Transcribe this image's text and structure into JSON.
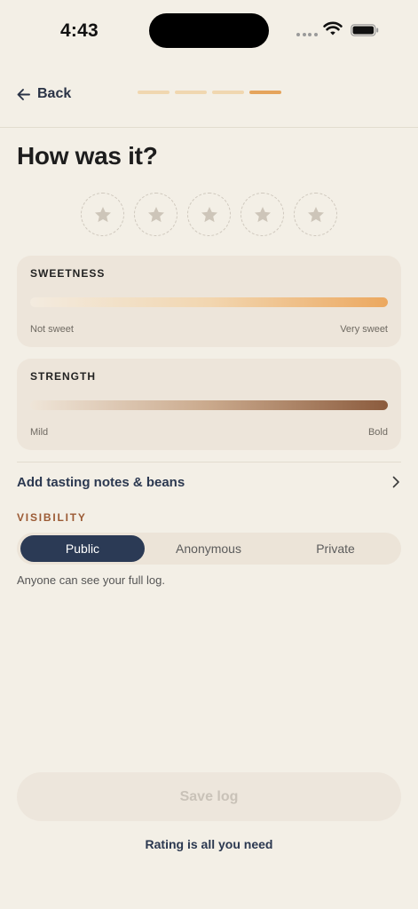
{
  "status_bar": {
    "time": "4:43",
    "icons": [
      "signal-dots-icon",
      "wifi-icon",
      "battery-icon"
    ]
  },
  "header": {
    "back_label": "Back",
    "progress": {
      "steps": 4,
      "current": 4
    }
  },
  "title": "How was it?",
  "rating": {
    "max": 5,
    "value": 0,
    "icon": "star-icon"
  },
  "sliders": [
    {
      "label": "SWEETNESS",
      "min_label": "Not sweet",
      "max_label": "Very sweet"
    },
    {
      "label": "STRENGTH",
      "min_label": "Mild",
      "max_label": "Bold"
    }
  ],
  "notes_row": {
    "label": "Add tasting notes & beans",
    "icon": "chevron-right-icon"
  },
  "visibility": {
    "label": "VISIBILITY",
    "options": [
      "Public",
      "Anonymous",
      "Private"
    ],
    "selected": "Public",
    "help": "Anyone can see your full log."
  },
  "save_label": "Save log",
  "footer_note": "Rating is all you need",
  "colors": {
    "background": "#f3efe6",
    "card": "#ede5da",
    "accent_navy": "#2b3a55",
    "accent_orange": "#e5a45c",
    "label_brown": "#9b5a34"
  }
}
